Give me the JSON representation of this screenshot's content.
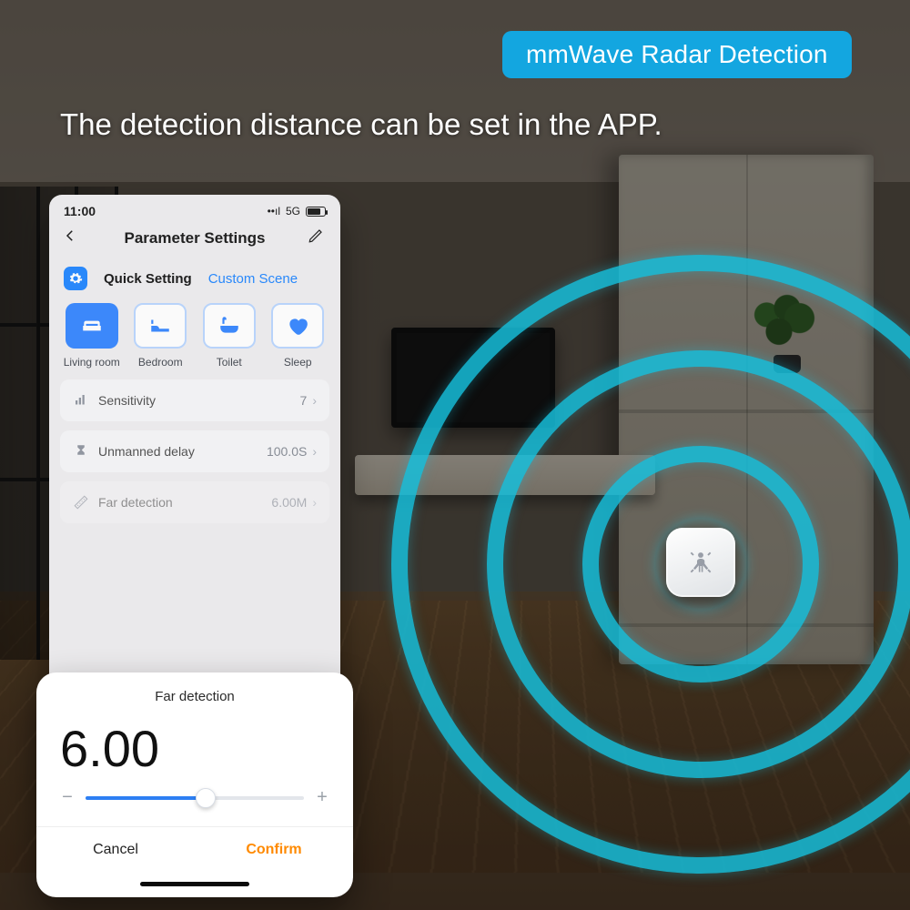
{
  "badge": "mmWave Radar Detection",
  "headline": "The detection distance can be set in the APP.",
  "status": {
    "time": "11:00",
    "network": "5G"
  },
  "navbar": {
    "title": "Parameter Settings"
  },
  "tabs": {
    "quick": "Quick Setting",
    "custom": "Custom Scene"
  },
  "tiles": [
    {
      "label": "Living room"
    },
    {
      "label": "Bedroom"
    },
    {
      "label": "Toilet"
    },
    {
      "label": "Sleep"
    }
  ],
  "rows": {
    "sensitivity": {
      "label": "Sensitivity",
      "value": "7"
    },
    "unmanned": {
      "label": "Unmanned delay",
      "value": "100.0S"
    },
    "far": {
      "label": "Far detection",
      "value": "6.00M"
    }
  },
  "sheet": {
    "title": "Far detection",
    "value": "6.00",
    "cancel": "Cancel",
    "confirm": "Confirm"
  }
}
